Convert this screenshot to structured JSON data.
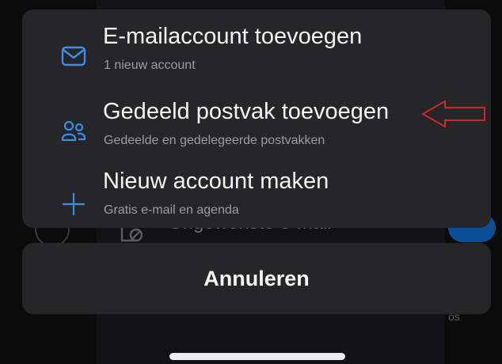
{
  "menu": {
    "items": [
      {
        "title": "E-mailaccount toevoegen",
        "subtitle": "1 nieuw account",
        "icon": "mail-icon"
      },
      {
        "title": "Gedeeld postvak toevoegen",
        "subtitle": "Gedeelde en gedelegeerde postvakken",
        "icon": "people-icon"
      },
      {
        "title": "Nieuw account maken",
        "subtitle": "Gratis e-mail en agenda",
        "icon": "plus-icon"
      }
    ],
    "cancel_label": "Annuleren"
  },
  "background": {
    "obscured_item_label": "Ongewenste e-mail",
    "partial_text": "os"
  },
  "colors": {
    "accent": "#3a8ee8",
    "sheet": "#262628",
    "annotation": "#e0292c"
  }
}
